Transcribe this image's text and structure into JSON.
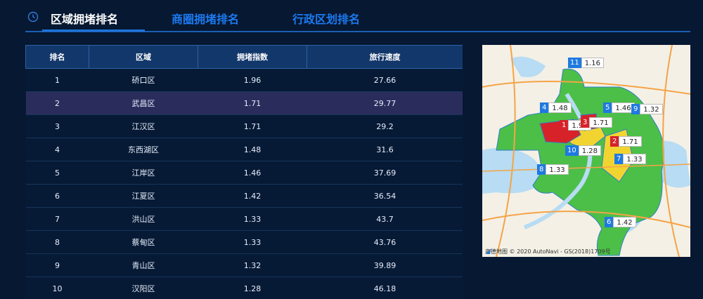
{
  "tabs": [
    {
      "label": "区域拥堵排名",
      "active": true
    },
    {
      "label": "商圈拥堵排名",
      "active": false
    },
    {
      "label": "行政区划排名",
      "active": false
    }
  ],
  "table": {
    "headers": [
      "排名",
      "区域",
      "拥堵指数",
      "旅行速度"
    ],
    "rows": [
      [
        "1",
        "硚口区",
        "1.96",
        "27.66"
      ],
      [
        "2",
        "武昌区",
        "1.71",
        "29.77"
      ],
      [
        "3",
        "江汉区",
        "1.71",
        "29.2"
      ],
      [
        "4",
        "东西湖区",
        "1.48",
        "31.6"
      ],
      [
        "5",
        "江岸区",
        "1.46",
        "37.69"
      ],
      [
        "6",
        "江夏区",
        "1.42",
        "36.54"
      ],
      [
        "7",
        "洪山区",
        "1.33",
        "43.7"
      ],
      [
        "8",
        "蔡甸区",
        "1.33",
        "43.76"
      ],
      [
        "9",
        "青山区",
        "1.32",
        "39.89"
      ],
      [
        "10",
        "汉阳区",
        "1.28",
        "46.18"
      ]
    ],
    "highlight_row": 1
  },
  "map": {
    "markers": [
      {
        "rank": "11",
        "value": "1.16",
        "color": "#1e7ae0"
      },
      {
        "rank": "4",
        "value": "1.48",
        "color": "#1e7ae0"
      },
      {
        "rank": "5",
        "value": "1.46",
        "color": "#1e7ae0"
      },
      {
        "rank": "9",
        "value": "1.32",
        "color": "#1e7ae0"
      },
      {
        "rank": "1",
        "value": "1.96",
        "color": "#d8222a"
      },
      {
        "rank": "3",
        "value": "1.71",
        "color": "#d8222a"
      },
      {
        "rank": "2",
        "value": "1.71",
        "color": "#d8222a"
      },
      {
        "rank": "10",
        "value": "1.28",
        "color": "#1e7ae0"
      },
      {
        "rank": "7",
        "value": "1.33",
        "color": "#1e7ae0"
      },
      {
        "rank": "8",
        "value": "1.33",
        "color": "#1e7ae0"
      },
      {
        "rank": "6",
        "value": "1.42",
        "color": "#1e7ae0"
      }
    ],
    "footer": "高德地图 © 2020 AutoNavi - GS(2018)1709号",
    "colors": {
      "green": "#4cbf48",
      "yellow": "#f2d430",
      "red": "#d8222a"
    }
  }
}
